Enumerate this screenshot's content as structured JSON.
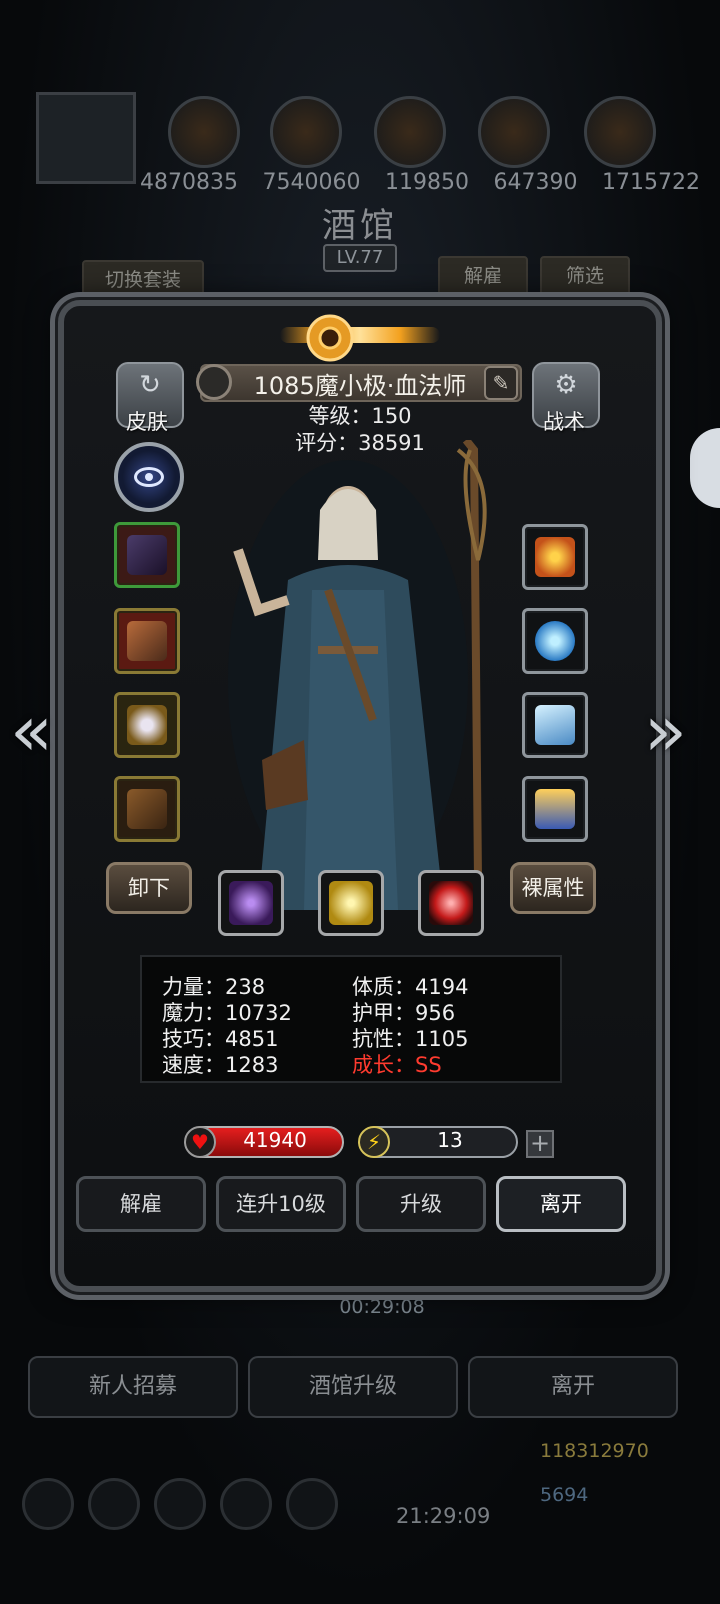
{
  "background": {
    "resources": [
      "4870835",
      "7540060",
      "119850",
      "647390",
      "1715722"
    ],
    "title": "酒馆",
    "level": "LV.77",
    "switch_outfit": "切换套装",
    "dismiss": "解雇",
    "filter": "筛选",
    "timer": "00:29:08",
    "bottom_buttons": [
      "新人招募",
      "酒馆升级",
      "离开"
    ],
    "gold": "118312970",
    "gems": "5694",
    "clock": "21:29:09"
  },
  "hero": {
    "name": "1085魔小极·血法师",
    "level": "等级：150",
    "score": "评分：38591",
    "skin_label": "皮肤",
    "tactics_label": "战术",
    "unequip_label": "卸下",
    "bare_stats_label": "裸属性"
  },
  "equipment": {
    "left": [
      "staff",
      "armor",
      "amulet",
      "belt"
    ],
    "right": [
      "fire-relic",
      "crystal-orb",
      "ice-shard",
      "lantern"
    ],
    "gems": [
      "purple-gem",
      "gold-gem",
      "red-gem"
    ]
  },
  "stats": {
    "strength": "力量：238",
    "constitution": "体质：4194",
    "magic": "魔力：10732",
    "armor": "护甲：956",
    "skill": "技巧：4851",
    "resist": "抗性：1105",
    "speed": "速度：1283",
    "growth": "成长：SS"
  },
  "bars": {
    "hp": "41940",
    "energy": "13",
    "energy_fill": 0.13
  },
  "actions": [
    "解雇",
    "连升10级",
    "升级",
    "离开"
  ],
  "colors": {
    "growth": "#ff3b2f",
    "hp": "#e51e1e",
    "energy": "#f4cd19"
  }
}
